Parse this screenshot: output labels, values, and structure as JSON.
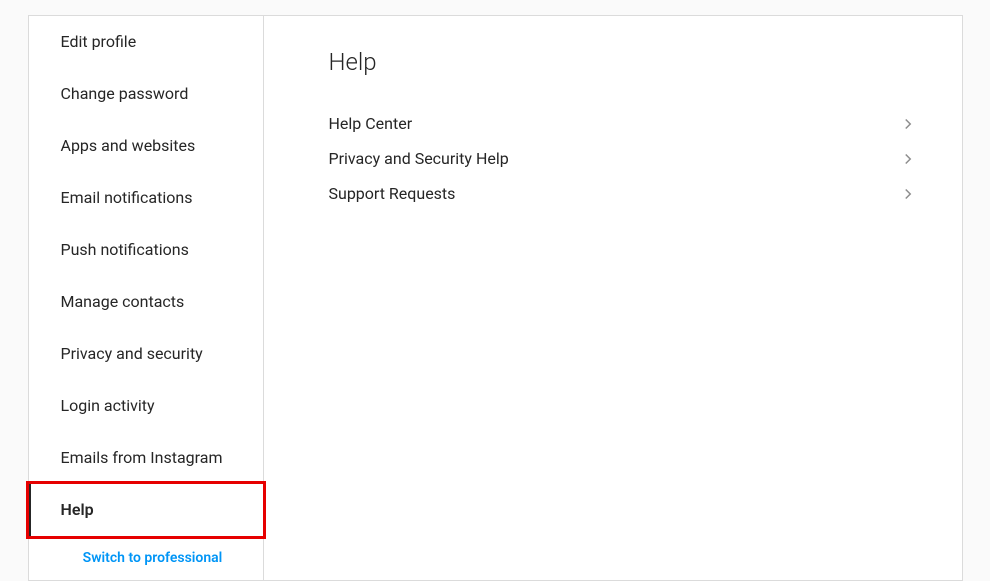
{
  "sidebar": {
    "items": [
      {
        "label": "Edit profile"
      },
      {
        "label": "Change password"
      },
      {
        "label": "Apps and websites"
      },
      {
        "label": "Email notifications"
      },
      {
        "label": "Push notifications"
      },
      {
        "label": "Manage contacts"
      },
      {
        "label": "Privacy and security"
      },
      {
        "label": "Login activity"
      },
      {
        "label": "Emails from Instagram"
      },
      {
        "label": "Help",
        "active": true,
        "highlighted": true
      }
    ],
    "switch_link": "Switch to professional"
  },
  "main": {
    "title": "Help",
    "items": [
      {
        "label": "Help Center"
      },
      {
        "label": "Privacy and Security Help"
      },
      {
        "label": "Support Requests"
      }
    ]
  }
}
